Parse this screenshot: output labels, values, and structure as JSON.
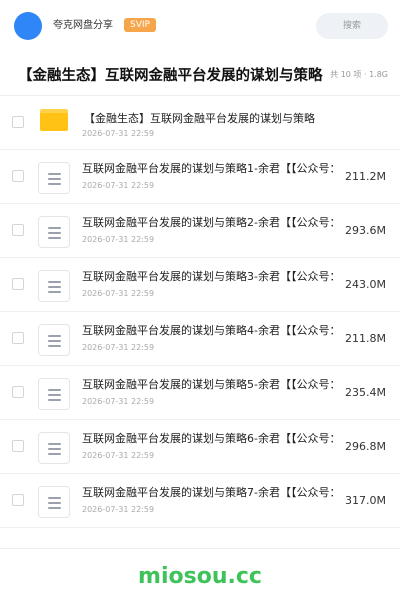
{
  "header": {
    "username": "夸克网盘分享",
    "badge": "SVIP",
    "search_placeholder": "搜索"
  },
  "share": {
    "title": "【金融生态】互联网金融平台发展的谋划与策略",
    "meta": "共 10 项 · 1.8G"
  },
  "folder": {
    "name": "【金融生态】互联网金融平台发展的谋划与策略",
    "date": "2026-07-31 22:59"
  },
  "files": [
    {
      "name": "互联网金融平台发展的谋划与策略1-余君【【公众号：",
      "date": "2026-07-31 22:59",
      "size": "211.2M"
    },
    {
      "name": "互联网金融平台发展的谋划与策略2-余君【【公众号：",
      "date": "2026-07-31 22:59",
      "size": "293.6M"
    },
    {
      "name": "互联网金融平台发展的谋划与策略3-余君【【公众号：",
      "date": "2026-07-31 22:59",
      "size": "243.0M"
    },
    {
      "name": "互联网金融平台发展的谋划与策略4-余君【【公众号：",
      "date": "2026-07-31 22:59",
      "size": "211.8M"
    },
    {
      "name": "互联网金融平台发展的谋划与策略5-余君【【公众号：",
      "date": "2026-07-31 22:59",
      "size": "235.4M"
    },
    {
      "name": "互联网金融平台发展的谋划与策略6-余君【【公众号：",
      "date": "2026-07-31 22:59",
      "size": "296.8M"
    },
    {
      "name": "互联网金融平台发展的谋划与策略7-余君【【公众号：",
      "date": "2026-07-31 22:59",
      "size": "317.0M"
    }
  ],
  "footer": {
    "watermark": "miosou.cc"
  },
  "colors": {
    "avatar": "#2f86f6",
    "badge": "#f7a54a",
    "folder": "#ffc215",
    "watermark": "#3ec35a"
  }
}
